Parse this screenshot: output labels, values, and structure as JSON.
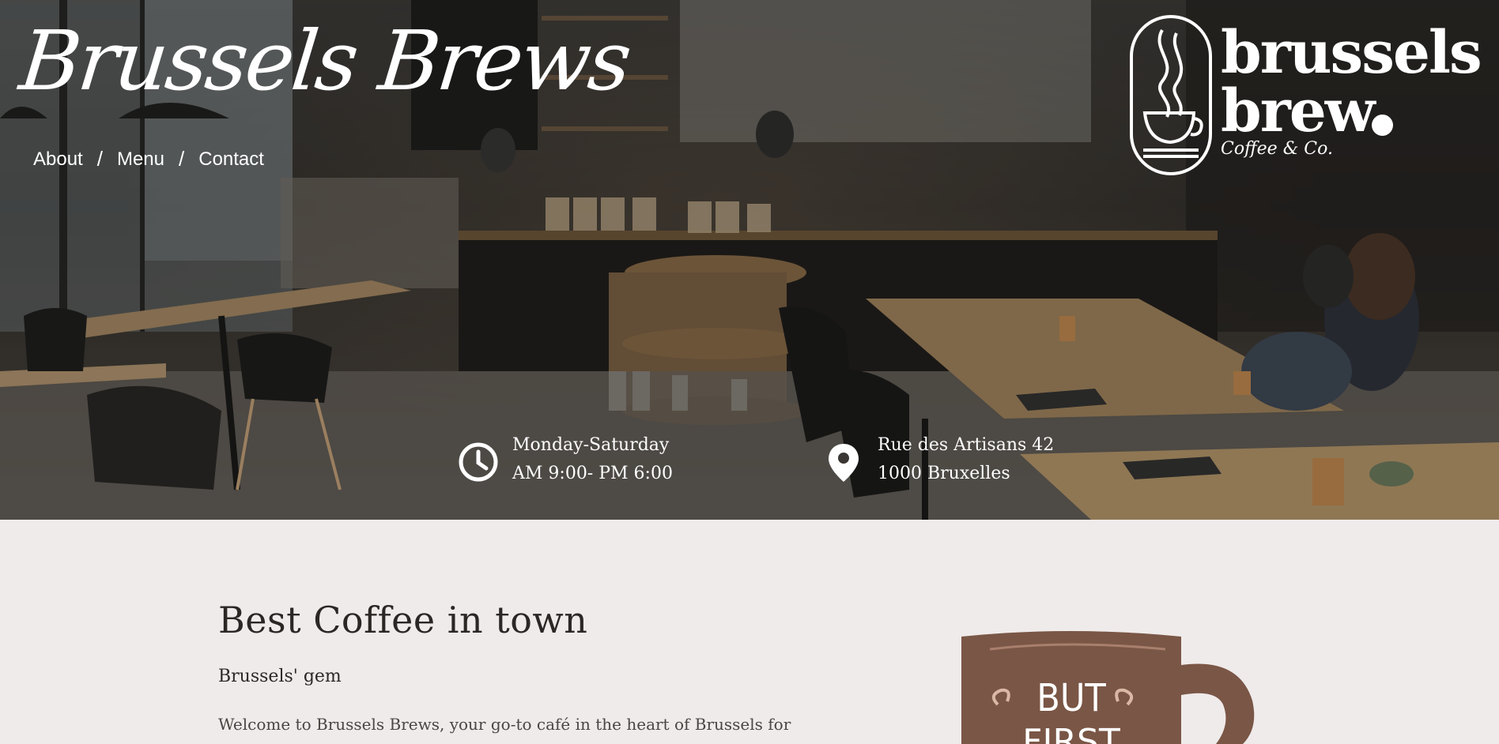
{
  "header": {
    "title": "Brussels Brews",
    "nav": [
      {
        "label": "About"
      },
      {
        "label": "Menu"
      },
      {
        "label": "Contact"
      }
    ],
    "separator": "/"
  },
  "logo": {
    "line1": "brussels",
    "line2": "brew",
    "tagline": "Coffee & Co."
  },
  "info": {
    "hours": {
      "line1": "Monday-Saturday",
      "line2": "AM 9:00- PM 6:00",
      "icon": "clock-icon"
    },
    "address": {
      "line1": "Rue des Artisans 42",
      "line2": "1000 Bruxelles",
      "icon": "map-pin-icon"
    }
  },
  "main": {
    "heading": "Best Coffee in town",
    "subheading": "Brussels' gem",
    "intro": "Welcome to Brussels Brews, your go-to café in the heart of Brussels for",
    "mug_text": [
      "BUT",
      "FIRST"
    ]
  },
  "colors": {
    "page_bg": "#efebea",
    "mug": "#7a5646",
    "text_dark": "#2a2725"
  }
}
